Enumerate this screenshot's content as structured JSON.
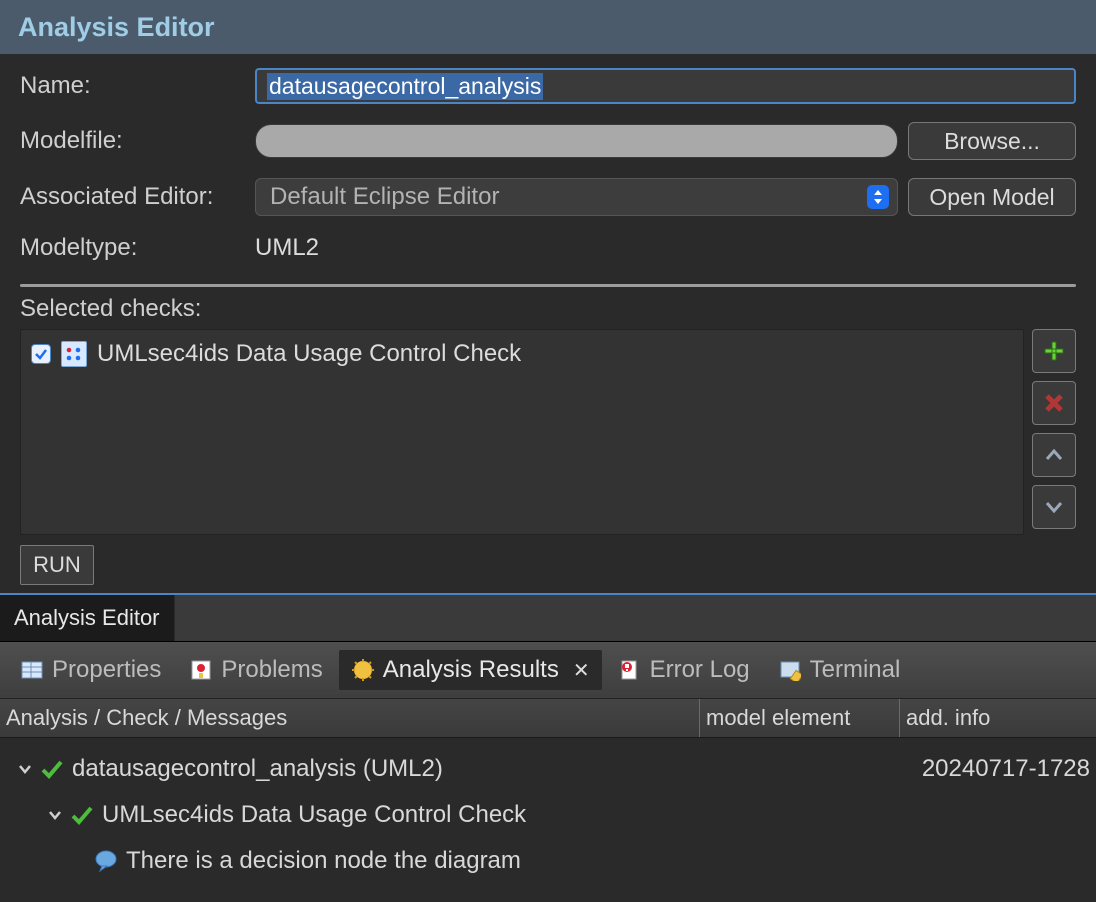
{
  "title": "Analysis Editor",
  "form": {
    "name_label": "Name:",
    "name_value": "datausagecontrol_analysis",
    "modelfile_label": "Modelfile:",
    "modelfile_value": "",
    "browse_label": "Browse...",
    "assoc_editor_label": "Associated Editor:",
    "assoc_editor_value": "Default Eclipse Editor",
    "open_model_label": "Open Model",
    "modeltype_label": "Modeltype:",
    "modeltype_value": "UML2"
  },
  "checks": {
    "header": "Selected checks:",
    "items": [
      {
        "checked": true,
        "label": "UMLsec4ids Data Usage Control Check"
      }
    ]
  },
  "run_label": "RUN",
  "editor_tab": "Analysis Editor",
  "views": {
    "properties": "Properties",
    "problems": "Problems",
    "analysis_results": "Analysis Results",
    "error_log": "Error Log",
    "terminal": "Terminal"
  },
  "table": {
    "col1": "Analysis / Check / Messages",
    "col2": "model element",
    "col3": "add. info"
  },
  "results": {
    "row1_text": "datausagecontrol_analysis (UML2)",
    "row1_info": "20240717-1728",
    "row2_text": "UMLsec4ids Data Usage Control Check",
    "row3_text": "There is a decision node the diagram"
  }
}
